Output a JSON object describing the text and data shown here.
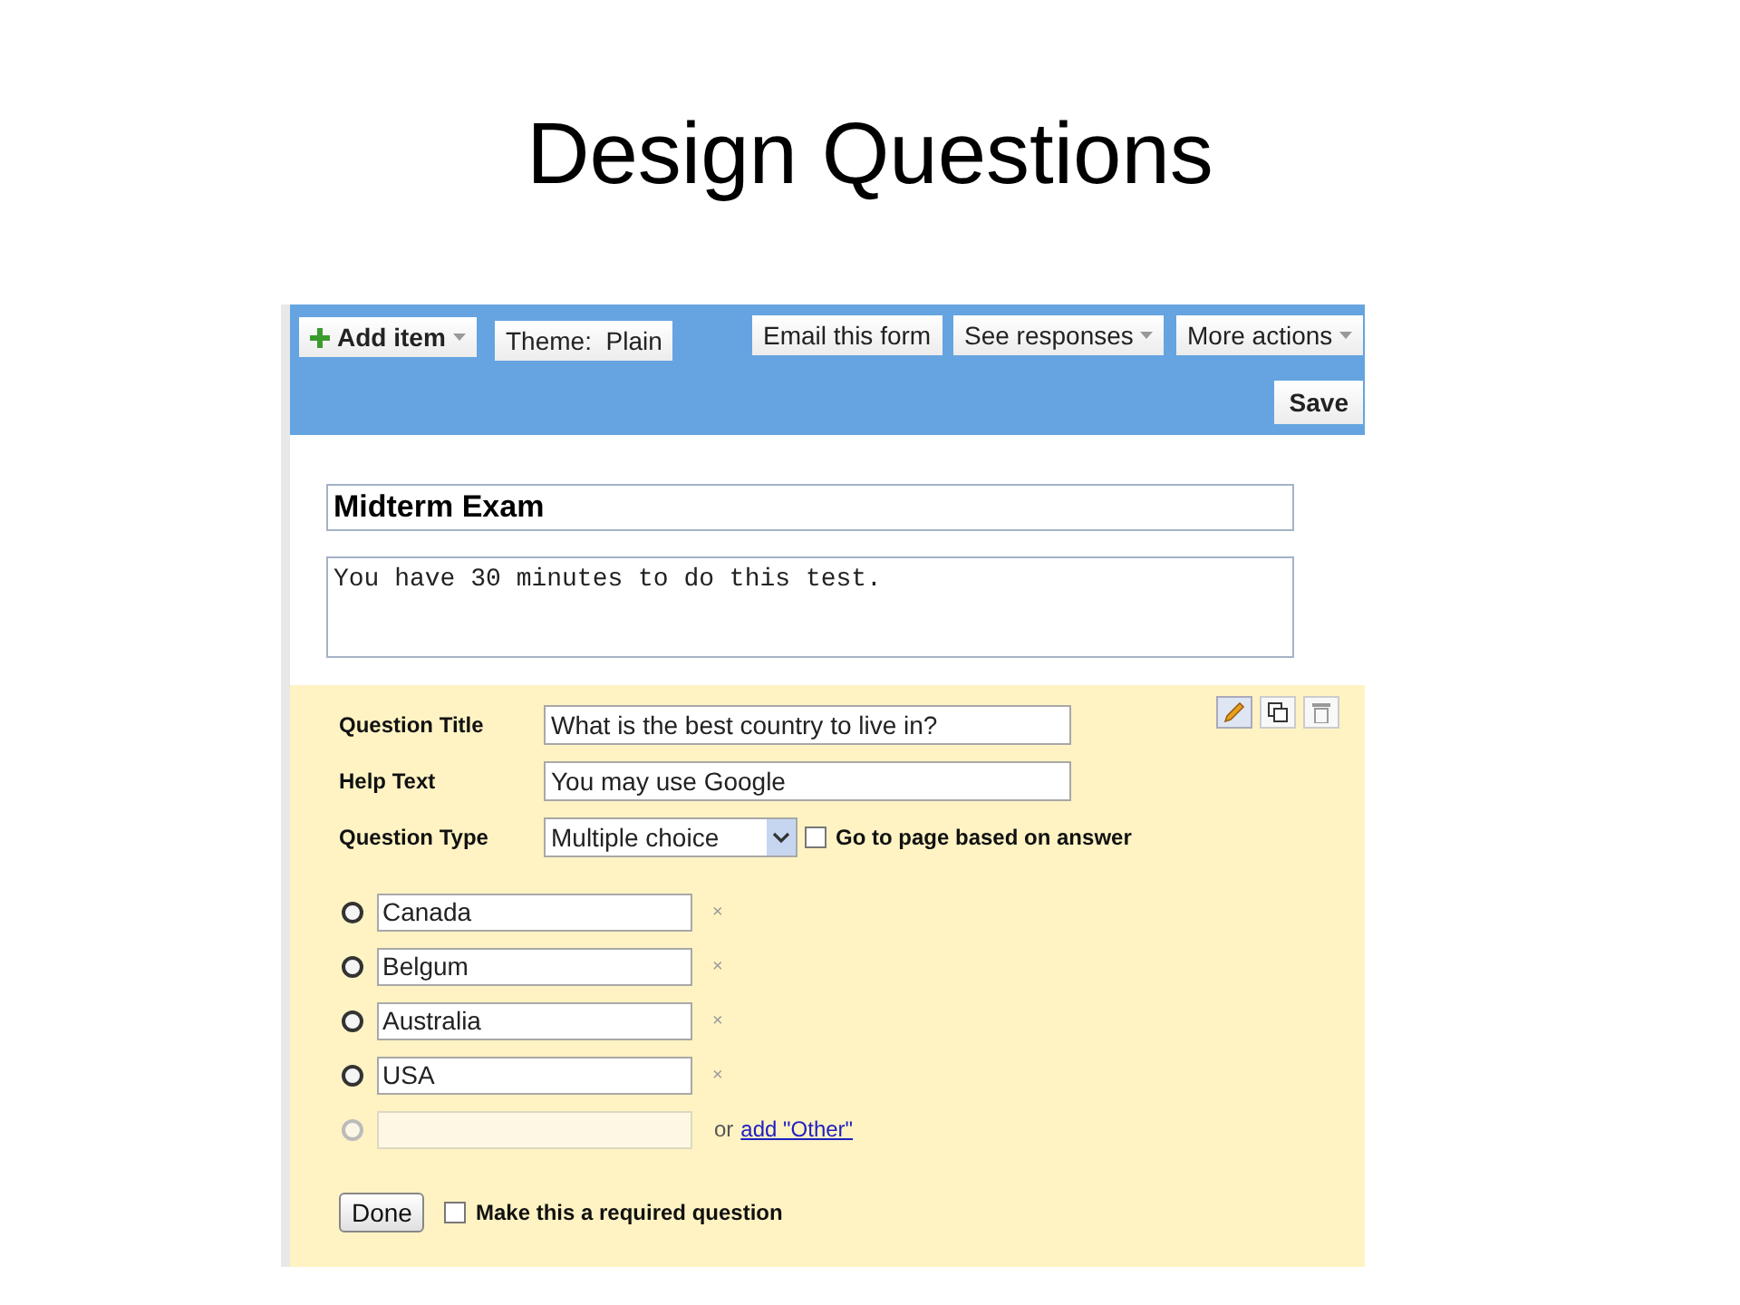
{
  "slide_title": "Design Questions",
  "toolbar": {
    "left": [
      {
        "label": "Add item",
        "kind": "add",
        "dropdown": true
      },
      {
        "label": "Theme:  Plain",
        "kind": "plain",
        "dropdown": false
      }
    ],
    "right": [
      {
        "label": "Email this form",
        "dropdown": false
      },
      {
        "label": "See responses",
        "dropdown": true
      },
      {
        "label": "More actions",
        "dropdown": true
      }
    ],
    "save": "Save"
  },
  "form": {
    "title": "Midterm Exam",
    "description": "You have 30 minutes to do this test."
  },
  "question": {
    "fields": [
      {
        "label": "Question Title",
        "value": "What is the best country to live in?"
      },
      {
        "label": "Help Text",
        "value": "You may use Google"
      }
    ],
    "type_label": "Question Type",
    "type_value": "Multiple choice",
    "page_branch": {
      "label": "Go to page based on answer",
      "checked": false
    },
    "options": [
      {
        "text": "Canada",
        "remove": "×",
        "selected": false
      },
      {
        "text": "Belgum",
        "remove": "×",
        "selected": false
      },
      {
        "text": "Australia",
        "remove": "×",
        "selected": false
      },
      {
        "text": "USA",
        "remove": "×",
        "selected": false
      }
    ],
    "new_option": {
      "prefix": "or",
      "link": "add \"Other\"",
      "selected": false
    },
    "done": "Done",
    "required": {
      "label": "Make this a required question",
      "checked": false
    }
  }
}
